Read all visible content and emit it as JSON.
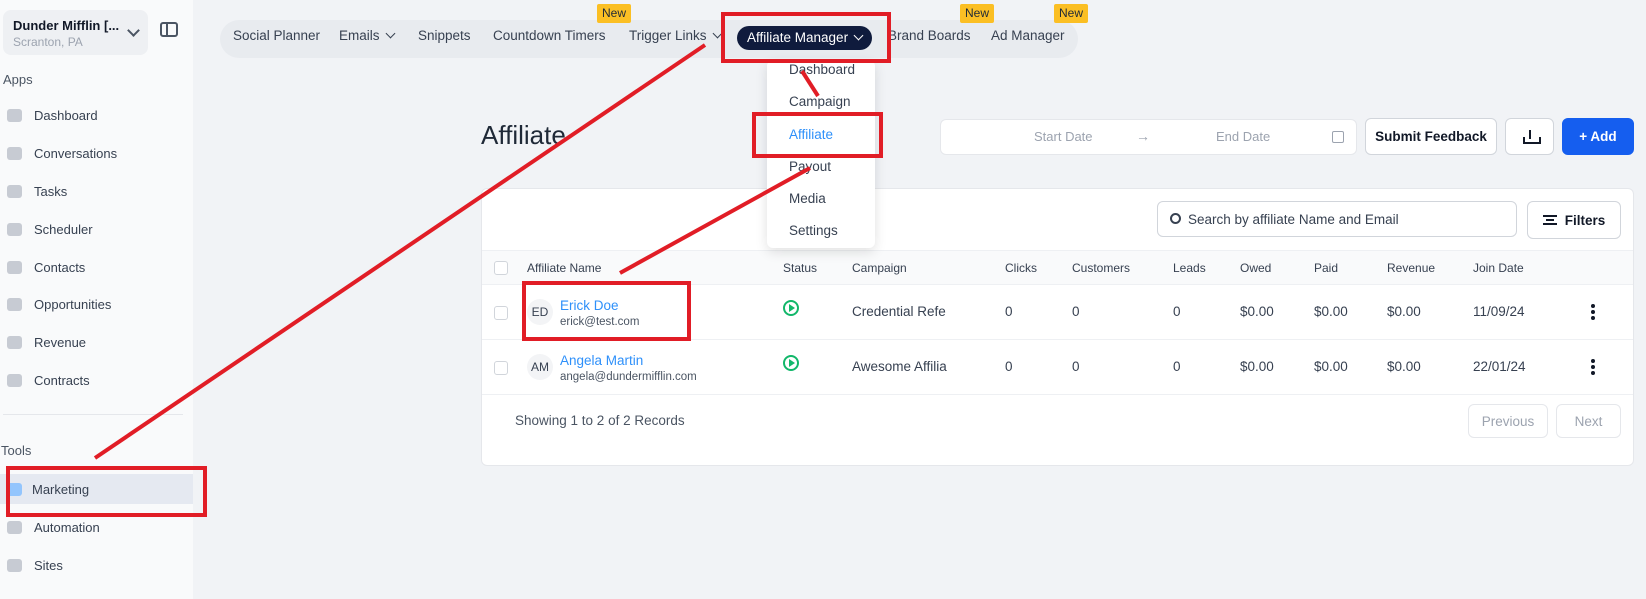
{
  "account": {
    "name": "Dunder Mifflin [...",
    "location": "Scranton, PA"
  },
  "sidebar": {
    "apps_label": "Apps",
    "apps": [
      {
        "label": "Dashboard",
        "icon": "dashboard-icon"
      },
      {
        "label": "Conversations",
        "icon": "conversations-icon"
      },
      {
        "label": "Tasks",
        "icon": "tasks-icon"
      },
      {
        "label": "Scheduler",
        "icon": "calendar-icon"
      },
      {
        "label": "Contacts",
        "icon": "contacts-icon"
      },
      {
        "label": "Opportunities",
        "icon": "opportunities-icon"
      },
      {
        "label": "Revenue",
        "icon": "revenue-icon"
      },
      {
        "label": "Contracts",
        "icon": "contracts-icon"
      }
    ],
    "tools_label": "Tools",
    "tools": [
      {
        "label": "Marketing",
        "icon": "marketing-icon"
      },
      {
        "label": "Automation",
        "icon": "automation-icon"
      },
      {
        "label": "Sites",
        "icon": "sites-icon"
      }
    ]
  },
  "topnav": {
    "tabs": [
      {
        "label": "Social Planner"
      },
      {
        "label": "Emails"
      },
      {
        "label": "Snippets"
      },
      {
        "label": "Countdown Timers"
      },
      {
        "label": "Trigger Links"
      },
      {
        "label": "Affiliate Manager"
      },
      {
        "label": "Brand Boards"
      },
      {
        "label": "Ad Manager"
      }
    ],
    "new_badge": "New"
  },
  "dropdown": {
    "items": [
      {
        "label": "Dashboard"
      },
      {
        "label": "Campaign"
      },
      {
        "label": "Affiliate"
      },
      {
        "label": "Payout"
      },
      {
        "label": "Media"
      },
      {
        "label": "Settings"
      }
    ]
  },
  "page": {
    "title": "Affiliate",
    "start_date": "Start Date",
    "end_date": "End Date",
    "arrow": "→",
    "submit_feedback": "Submit Feedback",
    "add_label": "+ Add"
  },
  "table": {
    "search_placeholder": "Search by affiliate Name and Email",
    "filters_label": "Filters",
    "columns": [
      "Affiliate Name",
      "Status",
      "Campaign",
      "Clicks",
      "Customers",
      "Leads",
      "Owed",
      "Paid",
      "Revenue",
      "Join Date"
    ],
    "rows": [
      {
        "initials": "ED",
        "name": "Erick Doe",
        "email": "erick@test.com",
        "campaign": "Credential Refe",
        "clicks": "0",
        "customers": "0",
        "leads": "0",
        "owed": "$0.00",
        "paid": "$0.00",
        "revenue": "$0.00",
        "join_date": "11/09/24"
      },
      {
        "initials": "AM",
        "name": "Angela Martin",
        "email": "angela@dundermifflin.com",
        "campaign": "Awesome Affilia",
        "clicks": "0",
        "customers": "0",
        "leads": "0",
        "owed": "$0.00",
        "paid": "$0.00",
        "revenue": "$0.00",
        "join_date": "22/01/24"
      }
    ],
    "showing": "Showing 1 to 2 of 2 Records",
    "previous": "Previous",
    "next": "Next"
  },
  "colors": {
    "accent": "#155eef",
    "link": "#2e90fa",
    "nav_active": "#0f1b3d",
    "annotation": "#e11d26",
    "badge": "#fbbf24"
  }
}
